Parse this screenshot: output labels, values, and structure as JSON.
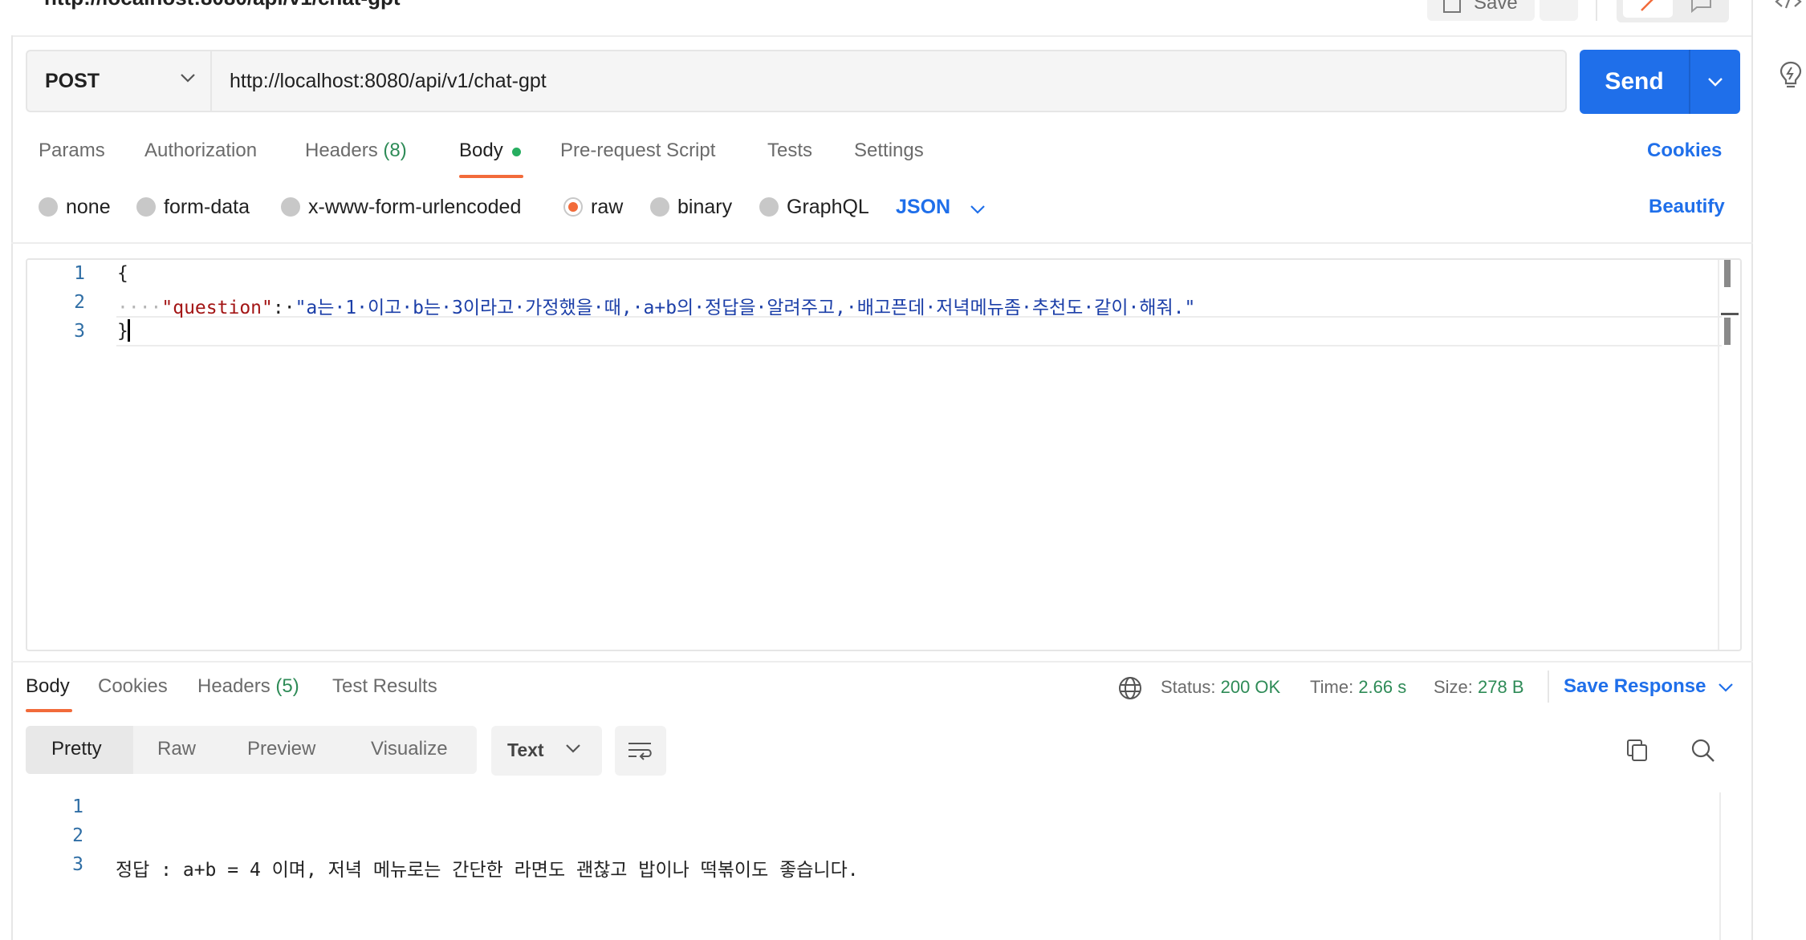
{
  "header": {
    "title": "http://localhost:8080/api/v1/chat-gpt",
    "save_label": "Save"
  },
  "request": {
    "method": "POST",
    "url": "http://localhost:8080/api/v1/chat-gpt",
    "send_label": "Send"
  },
  "request_tabs": {
    "params": "Params",
    "authorization": "Authorization",
    "headers": "Headers",
    "headers_count": "(8)",
    "body": "Body",
    "pre_request": "Pre-request Script",
    "tests": "Tests",
    "settings": "Settings",
    "cookies": "Cookies"
  },
  "body_types": {
    "none": "none",
    "form_data": "form-data",
    "urlencoded": "x-www-form-urlencoded",
    "raw": "raw",
    "binary": "binary",
    "graphql": "GraphQL",
    "selected": "raw",
    "format": "JSON",
    "beautify": "Beautify"
  },
  "editor": {
    "line_numbers": [
      "1",
      "2",
      "3"
    ],
    "line1": "{",
    "line2_indent": "····",
    "line2_key": "\"question\"",
    "line2_colon": ":·",
    "line2_value": "\"a는·1·이고·b는·3이라고·가정했을·때,·a+b의·정답을·알려주고,·배고픈데·저녁메뉴좀·추천도·같이·해줘.\"",
    "line3": "}"
  },
  "response_tabs": {
    "body": "Body",
    "cookies": "Cookies",
    "headers": "Headers",
    "headers_count": "(5)",
    "test_results": "Test Results"
  },
  "response_status": {
    "status_label": "Status:",
    "status_value": "200 OK",
    "time_label": "Time:",
    "time_value": "2.66 s",
    "size_label": "Size:",
    "size_value": "278 B",
    "save_response": "Save Response"
  },
  "response_view": {
    "pretty": "Pretty",
    "raw": "Raw",
    "preview": "Preview",
    "visualize": "Visualize",
    "format": "Text"
  },
  "response_body": {
    "line_numbers": [
      "1",
      "2",
      "3"
    ],
    "line3": "정답 : a+b = 4 이며, 저녁 메뉴로는 간단한 라면도 괜찮고 밥이나 떡볶이도 좋습니다."
  },
  "colors": {
    "accent": "#1f6fea",
    "active_tab": "#f26b3a",
    "count": "#2e8b57"
  }
}
